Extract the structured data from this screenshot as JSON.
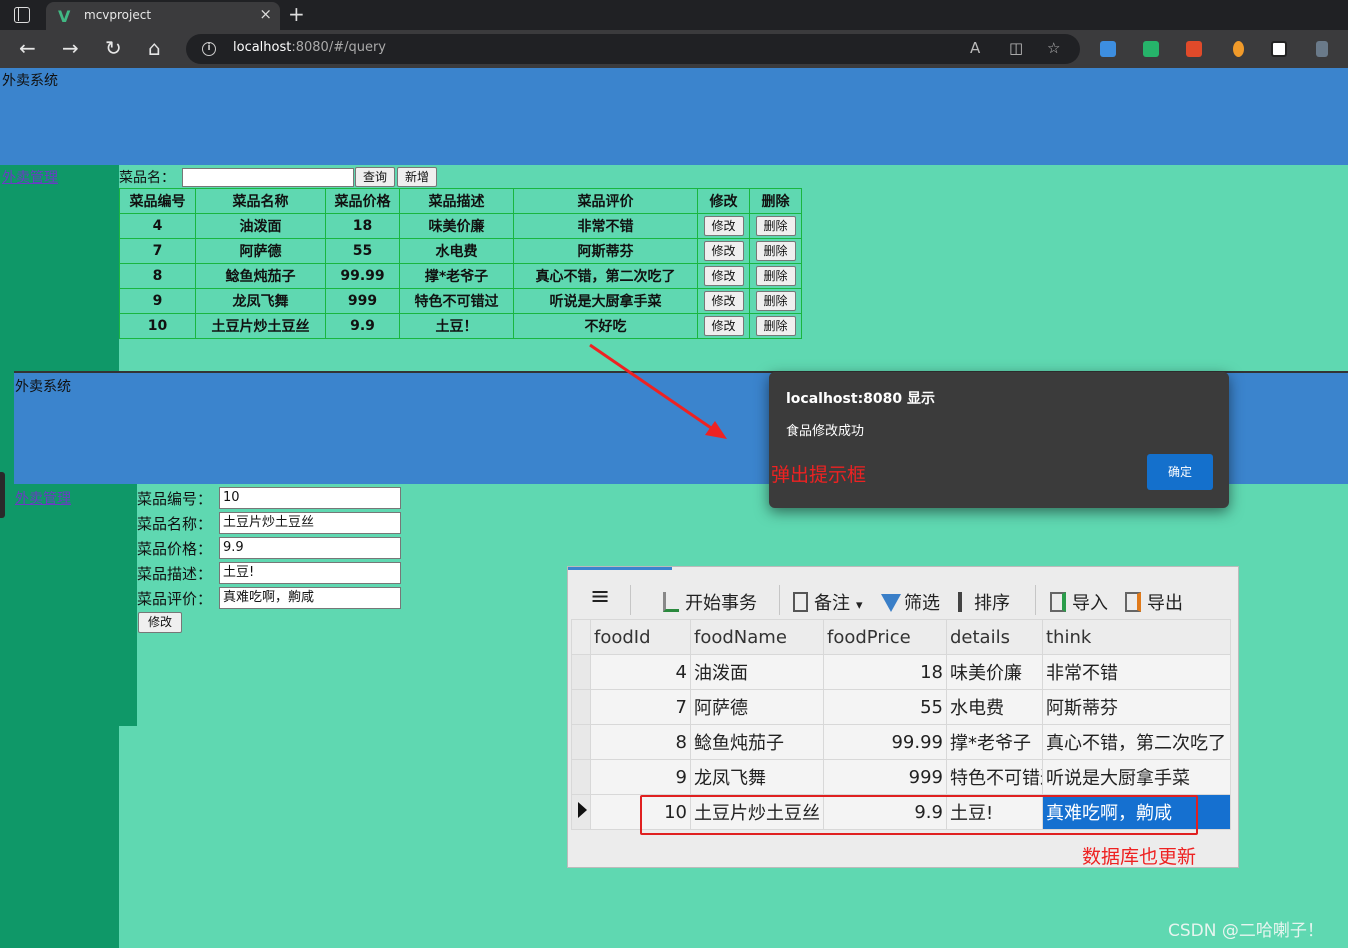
{
  "browser": {
    "tab_title": "mcvproject",
    "tab_logo": "V",
    "tab_close": "×",
    "new_tab": "+",
    "url_host": "localhost",
    "url_rest": ":8080/#/query",
    "nav_back": "←",
    "nav_forward": "→",
    "nav_reload": "↻",
    "nav_home": "⌂",
    "read_aloud": "A",
    "split": "◫",
    "favorite": "☆",
    "icons": [
      "vue-tab-icon",
      "back-arrow-icon",
      "forward-arrow-icon",
      "reload-icon",
      "home-icon",
      "site-info-icon",
      "read-aloud-icon",
      "split-screen-icon",
      "favorite-star-icon"
    ]
  },
  "app": {
    "title": "外卖系统",
    "sidebar_link": "外卖管理"
  },
  "query": {
    "search_label": "菜品名：",
    "search_value": "",
    "query_button": "查询",
    "add_button": "新增",
    "headers": [
      "菜品编号",
      "菜品名称",
      "菜品价格",
      "菜品描述",
      "菜品评价",
      "修改",
      "删除"
    ],
    "rows": [
      [
        "4",
        "油泼面",
        "18",
        "味美价廉",
        "非常不错"
      ],
      [
        "7",
        "阿萨德",
        "55",
        "水电费",
        "阿斯蒂芬"
      ],
      [
        "8",
        "鲶鱼炖茄子",
        "99.99",
        "撑*老爷子",
        "真心不错，第二次吃了"
      ],
      [
        "9",
        "龙凤飞舞",
        "999",
        "特色不可错过",
        "听说是大厨拿手菜"
      ],
      [
        "10",
        "土豆片炒土豆丝",
        "9.9",
        "土豆！",
        "不好吃"
      ]
    ],
    "edit_label": "修改",
    "delete_label": "删除"
  },
  "edit": {
    "app_title": "外卖系统",
    "sidebar_link": "外卖管理",
    "fields": [
      {
        "label": "菜品编号：",
        "value": "10"
      },
      {
        "label": "菜品名称：",
        "value": "土豆片炒土豆丝"
      },
      {
        "label": "菜品价格：",
        "value": "9.9"
      },
      {
        "label": "菜品描述：",
        "value": "土豆!"
      },
      {
        "label": "菜品评价：",
        "value": "真难吃啊，齁咸"
      }
    ],
    "submit_label": "修改"
  },
  "dialog": {
    "title": "localhost:8080 显示",
    "message": "食品修改成功",
    "ok_label": "确定",
    "annotation": "弹出提示框"
  },
  "db": {
    "toolbar": [
      "开始事务",
      "备注",
      "筛选",
      "排序",
      "导入",
      "导出"
    ],
    "menu_icon": "≡",
    "dropdown": "▾",
    "columns": [
      "foodId",
      "foodName",
      "foodPrice",
      "details",
      "think"
    ],
    "rows": [
      [
        "4",
        "油泼面",
        "18",
        "味美价廉",
        "非常不错"
      ],
      [
        "7",
        "阿萨德",
        "55",
        "水电费",
        "阿斯蒂芬"
      ],
      [
        "8",
        "鲶鱼炖茄子",
        "99.99",
        "撑*老爷子",
        "真心不错，第二次吃了"
      ],
      [
        "9",
        "龙凤飞舞",
        "999",
        "特色不可错过",
        "听说是大厨拿手菜"
      ],
      [
        "10",
        "土豆片炒土豆丝",
        "9.9",
        "土豆!",
        "真难吃啊，齁咸"
      ]
    ],
    "annotation": "数据库也更新"
  },
  "watermark": "CSDN @二哈喇子！",
  "colors": {
    "header_blue": "#3b84cd",
    "content_green": "#5fd8b1",
    "sidebar_green": "#0f9868",
    "annotation_red": "#ee2222",
    "selection_blue": "#1570d0"
  }
}
